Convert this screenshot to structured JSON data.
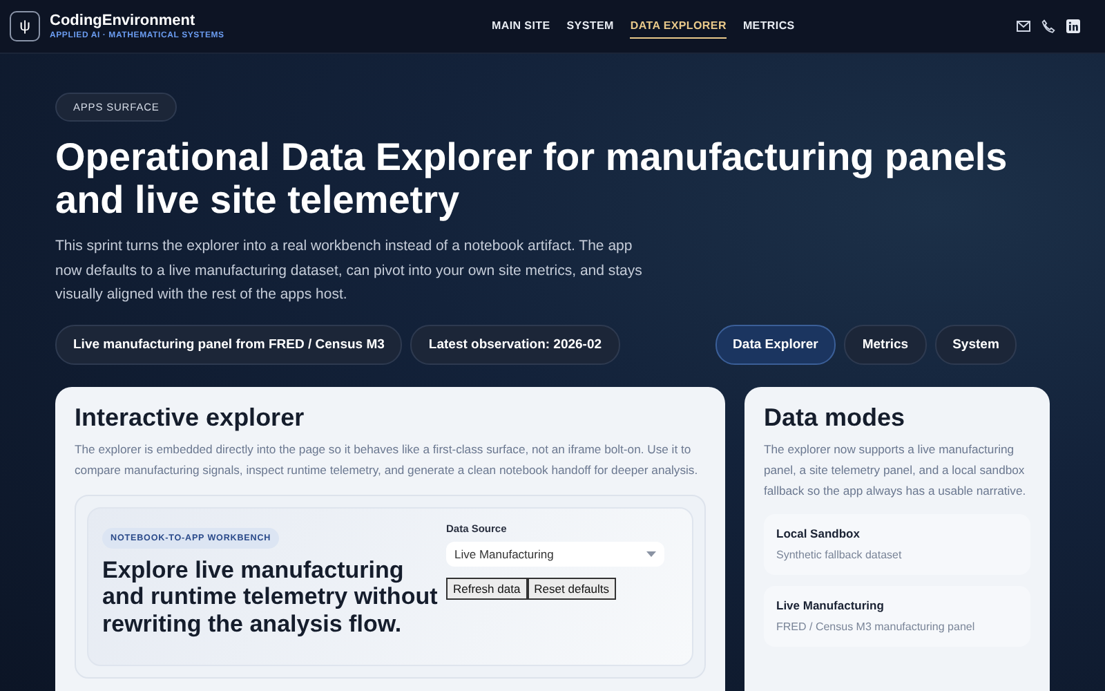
{
  "brand": {
    "name": "CodingEnvironment",
    "tagline": "APPLIED AI · MATHEMATICAL SYSTEMS",
    "logo_glyph": "ψ"
  },
  "nav": [
    {
      "label": "MAIN SITE",
      "selected": false
    },
    {
      "label": "SYSTEM",
      "selected": false
    },
    {
      "label": "DATA EXPLORER",
      "selected": true
    },
    {
      "label": "METRICS",
      "selected": false
    }
  ],
  "hero": {
    "eyebrow": "APPS SURFACE",
    "title": "Operational Data Explorer for manufacturing panels and live site telemetry",
    "lead": "This sprint turns the explorer into a real workbench instead of a notebook artifact. The app now defaults to a live manufacturing dataset, can pivot into your own site metrics, and stays visually aligned with the rest of the apps host.",
    "chips": [
      "Live manufacturing panel from FRED / Census M3",
      "Latest observation: 2026-02"
    ],
    "tabs": [
      {
        "label": "Data Explorer",
        "selected": true
      },
      {
        "label": "Metrics",
        "selected": false
      },
      {
        "label": "System",
        "selected": false
      }
    ]
  },
  "explorer": {
    "title": "Interactive explorer",
    "description": "The explorer is embedded directly into the page so it behaves like a first-class surface, not an iframe bolt-on. Use it to compare manufacturing signals, inspect runtime telemetry, and generate a clean notebook handoff for deeper analysis.",
    "badge": "NOTEBOOK-TO-APP WORKBENCH",
    "headline": "Explore live manufacturing and runtime telemetry without rewriting the analysis flow.",
    "source_label": "Data Source",
    "source_value": "Live Manufacturing",
    "buttons": [
      "Refresh data",
      "Reset defaults"
    ]
  },
  "modes": {
    "title": "Data modes",
    "description": "The explorer now supports a live manufacturing panel, a site telemetry panel, and a local sandbox fallback so the app always has a usable narrative.",
    "items": [
      {
        "name": "Local Sandbox",
        "detail": "Synthetic fallback dataset"
      },
      {
        "name": "Live Manufacturing",
        "detail": "FRED / Census M3 manufacturing panel"
      }
    ]
  }
}
